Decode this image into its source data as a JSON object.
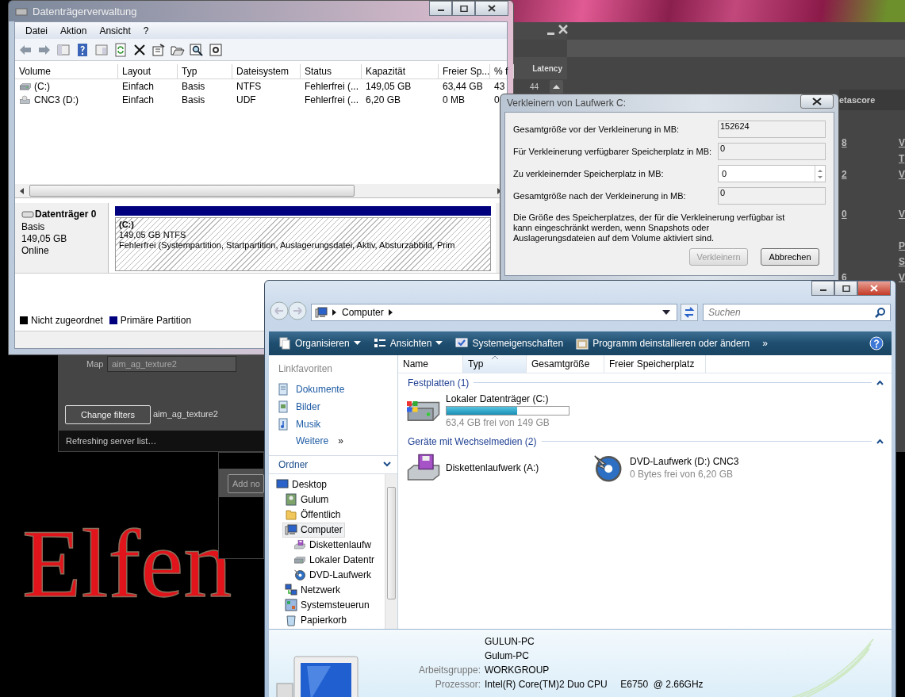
{
  "desktop": {
    "wallpaper_text": "Elfen"
  },
  "game_browser": {
    "latency_header": "Latency",
    "latency_value": "44",
    "metascore_header": "etascore",
    "score_fragments": [
      "8",
      "2",
      "0",
      "6"
    ],
    "link_fragments": [
      "V",
      "T",
      "V",
      "V",
      "P",
      "S",
      "V"
    ],
    "map_label": "Map",
    "map_value": "aim_ag_texture2",
    "change_filters_button": "Change filters",
    "current_map": "aim_ag_texture2",
    "status": "Refreshing server list…"
  },
  "server_panel": {
    "add_button": "Add no"
  },
  "disk_management": {
    "title": "Datenträgerverwaltung",
    "menu": [
      "Datei",
      "Aktion",
      "Ansicht",
      "?"
    ],
    "columns": [
      "Volume",
      "Layout",
      "Typ",
      "Dateisystem",
      "Status",
      "Kapazität",
      "Freier Sp...",
      "% f"
    ],
    "rows": [
      {
        "kind": "hdd",
        "cells": [
          "(C:)",
          "Einfach",
          "Basis",
          "NTFS",
          "Fehlerfrei (...",
          "149,05 GB",
          "63,44 GB",
          "43"
        ]
      },
      {
        "kind": "cd",
        "cells": [
          "CNC3 (D:)",
          "Einfach",
          "Basis",
          "UDF",
          "Fehlerfrei (...",
          "6,20 GB",
          "0 MB",
          "0"
        ]
      }
    ],
    "disk": {
      "name": "Datenträger 0",
      "type": "Basis",
      "size": "149,05 GB",
      "status": "Online"
    },
    "partition": {
      "label": "(C:)",
      "size": "149,05 GB NTFS",
      "status": "Fehlerfrei (Systempartition, Startpartition, Auslagerungsdatei, Aktiv, Absturzabbild, Prim"
    },
    "legend": [
      {
        "label": "Nicht zugeordnet",
        "color": "#000000"
      },
      {
        "label": "Primäre Partition",
        "color": "#00007f"
      }
    ]
  },
  "shrink_dialog": {
    "title": "Verkleinern von Laufwerk C:",
    "fields": [
      {
        "label": "Gesamtgröße vor der Verkleinerung in MB:",
        "value": "152624",
        "kind": "readonly"
      },
      {
        "label": "Für Verkleinerung verfügbarer Speicherplatz in MB:",
        "value": "0",
        "kind": "readonly"
      },
      {
        "label": "Zu verkleinernder Speicherplatz in MB:",
        "value": "0",
        "kind": "spin"
      },
      {
        "label": "Gesamtgröße nach der Verkleinerung in MB:",
        "value": "0",
        "kind": "readonly"
      }
    ],
    "note": "Die Größe des Speicherplatzes, der für die Verkleinerung verfügbar ist kann eingeschränkt werden, wenn Snapshots oder Auslagerungsdateien auf dem Volume aktiviert sind.",
    "buttons": [
      {
        "label": "Verkleinern",
        "disabled": true
      },
      {
        "label": "Abbrechen",
        "disabled": false
      }
    ]
  },
  "explorer": {
    "address": "Computer",
    "search": {
      "placeholder": "Suchen"
    },
    "commands": [
      {
        "label": "Organisieren",
        "dropdown": true
      },
      {
        "label": "Ansichten",
        "dropdown": true
      },
      {
        "label": "Systemeigenschaften",
        "dropdown": false
      },
      {
        "label": "Programm deinstallieren oder ändern",
        "dropdown": false
      }
    ],
    "more_commands": "»",
    "favorites_header": "Linkfavoriten",
    "favorites": [
      "Dokumente",
      "Bilder",
      "Musik"
    ],
    "more_favorites": "Weitere",
    "more_favorites_arrow": "»",
    "folders_header": "Ordner",
    "tree": [
      {
        "label": "Desktop",
        "kind": "desktop",
        "selected": false,
        "children": [
          {
            "label": "Gulum",
            "kind": "user",
            "selected": false
          },
          {
            "label": "Öffentlich",
            "kind": "folder",
            "selected": false
          },
          {
            "label": "Computer",
            "kind": "computer",
            "selected": true,
            "children": [
              {
                "label": "Diskettenlaufw",
                "kind": "floppy",
                "selected": false
              },
              {
                "label": "Lokaler Datentr",
                "kind": "hdd",
                "selected": false
              },
              {
                "label": "DVD-Laufwerk",
                "kind": "dvd",
                "selected": false
              }
            ]
          },
          {
            "label": "Netzwerk",
            "kind": "network",
            "selected": false
          },
          {
            "label": "Systemsteuerun",
            "kind": "control",
            "selected": false
          },
          {
            "label": "Papierkorb",
            "kind": "recycle",
            "selected": false
          }
        ]
      }
    ],
    "columns": [
      {
        "label": "Name",
        "sorted": false
      },
      {
        "label": "Typ",
        "sorted": true
      },
      {
        "label": "Gesamtgröße",
        "sorted": false
      },
      {
        "label": "Freier Speicherplatz",
        "sorted": false
      }
    ],
    "groups": [
      {
        "title": "Festplatten (1)",
        "items": [
          {
            "kind": "hdd",
            "name": "Lokaler Datenträger (C:)",
            "level": 0.575,
            "free": "63,4 GB frei von 149 GB"
          }
        ]
      },
      {
        "title": "Geräte mit Wechselmedien (2)",
        "items": [
          {
            "kind": "floppy",
            "name": "Diskettenlaufwerk (A:)"
          },
          {
            "kind": "dvd",
            "name": "DVD-Laufwerk (D:) CNC3",
            "free": "0 Bytes frei von 6,20 GB"
          }
        ]
      }
    ],
    "details": {
      "name": "GULUN-PC",
      "description": "Gulum-PC",
      "properties": [
        {
          "label": "Arbeitsgruppe:",
          "value": "WORKGROUP"
        },
        {
          "label": "Prozessor:",
          "value": "Intel(R) Core(TM)2 Duo CPU     E6750  @ 2.66GHz"
        }
      ]
    }
  }
}
